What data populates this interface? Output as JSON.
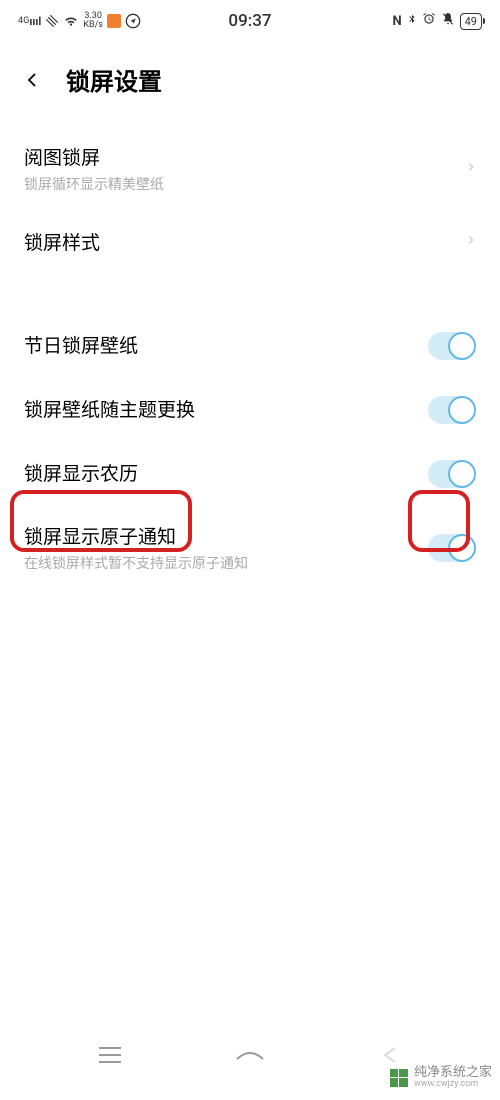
{
  "statusBar": {
    "network": "4G",
    "speed": "3.30",
    "speedUnit": "KB/s",
    "time": "09:37",
    "battery": "49"
  },
  "header": {
    "title": "锁屏设置"
  },
  "items": [
    {
      "title": "阅图锁屏",
      "subtitle": "锁屏循环显示精美壁纸",
      "type": "nav"
    },
    {
      "title": "锁屏样式",
      "subtitle": "",
      "type": "nav"
    },
    {
      "title": "节日锁屏壁纸",
      "subtitle": "",
      "type": "toggle",
      "on": true
    },
    {
      "title": "锁屏壁纸随主题更换",
      "subtitle": "",
      "type": "toggle",
      "on": true
    },
    {
      "title": "锁屏显示农历",
      "subtitle": "",
      "type": "toggle",
      "on": true
    },
    {
      "title": "锁屏显示原子通知",
      "subtitle": "在线锁屏样式暂不支持显示原子通知",
      "type": "toggle",
      "on": true
    }
  ],
  "watermark": {
    "name": "纯净系统之家",
    "url": "www.cwjzy.com"
  }
}
